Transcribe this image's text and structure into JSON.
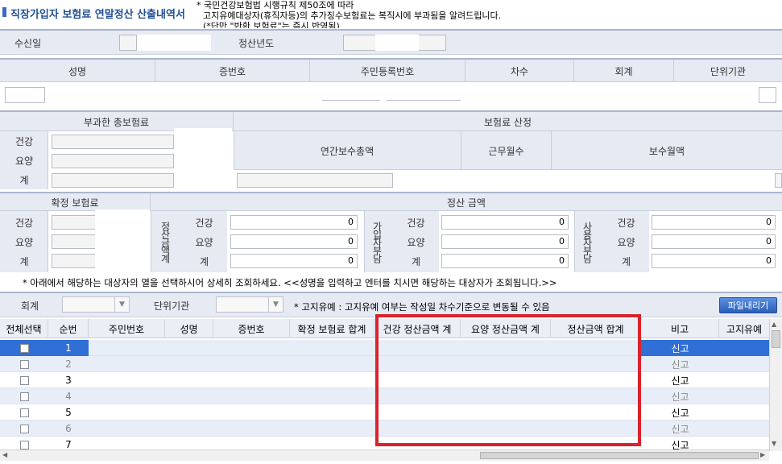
{
  "title": "직장가입자 보험료 연말정산 산출내역서",
  "notice": {
    "line1": "* 국민건강보험법 시행규칙 제50조에 따라",
    "line2": "고지유예대상자(휴직자등)의 추가징수보험료는 복직시에 부과됨을 알려드립니다.",
    "line3": "(*단만 \"반환 보험료\"는 즉시 반영됨)"
  },
  "header_row": {
    "received_label": "수신일",
    "settle_year_label": "정산년도"
  },
  "person_cols": [
    "성명",
    "증번호",
    "주민등록번호",
    "차수",
    "회계",
    "단위기관"
  ],
  "premium": {
    "imposed_title": "부과한 총보험료",
    "calc_title": "보험료 산정",
    "rows": [
      "건강",
      "요양",
      "계"
    ],
    "annual_pay": "연간보수총액",
    "months": "근무월수",
    "monthly_pay": "보수월액"
  },
  "settle": {
    "confirmed_title": "확정 보험료",
    "amount_title": "정산 금액",
    "rows": [
      "건강",
      "요양",
      "계"
    ],
    "group1": "정산금액계",
    "group2": "가입자부담",
    "group3": "사용자부담",
    "g1_values": [
      "0",
      "0",
      "0"
    ],
    "g2_values": [
      "0",
      "0",
      "0"
    ],
    "g3_values": [
      "0",
      "0",
      "0"
    ]
  },
  "instruction": "* 아래에서 해당하는 대상자의 열을 선택하시어 상세히 조회하세요. <<성명을 입력하고 엔터를 치시면 해당하는 대상자가 조회됩니다.>>",
  "filter": {
    "account_label": "회계",
    "unit_label": "단위기관",
    "note": "* 고지유예 : 고지유예 여부는 작성일 차수기준으로 변동될 수 있음",
    "download_button": "파일내리기"
  },
  "grid": {
    "columns": [
      "전체선택",
      "순번",
      "주민번호",
      "성명",
      "증번호",
      "확정 보험료 합계",
      "건강 정산금액 계",
      "요양 정산금액 계",
      "정산금액 합계",
      "비고",
      "고지유예"
    ],
    "rows": [
      {
        "no": "1",
        "note": "신고"
      },
      {
        "no": "2",
        "note": "신고"
      },
      {
        "no": "3",
        "note": "신고"
      },
      {
        "no": "4",
        "note": "신고"
      },
      {
        "no": "5",
        "note": "신고"
      },
      {
        "no": "6",
        "note": "신고"
      },
      {
        "no": "7",
        "note": "신고"
      }
    ]
  },
  "colors": {
    "highlight": "#d9232d",
    "selected_row": "#2f6fd6",
    "header_bg": "#e9edf5"
  }
}
